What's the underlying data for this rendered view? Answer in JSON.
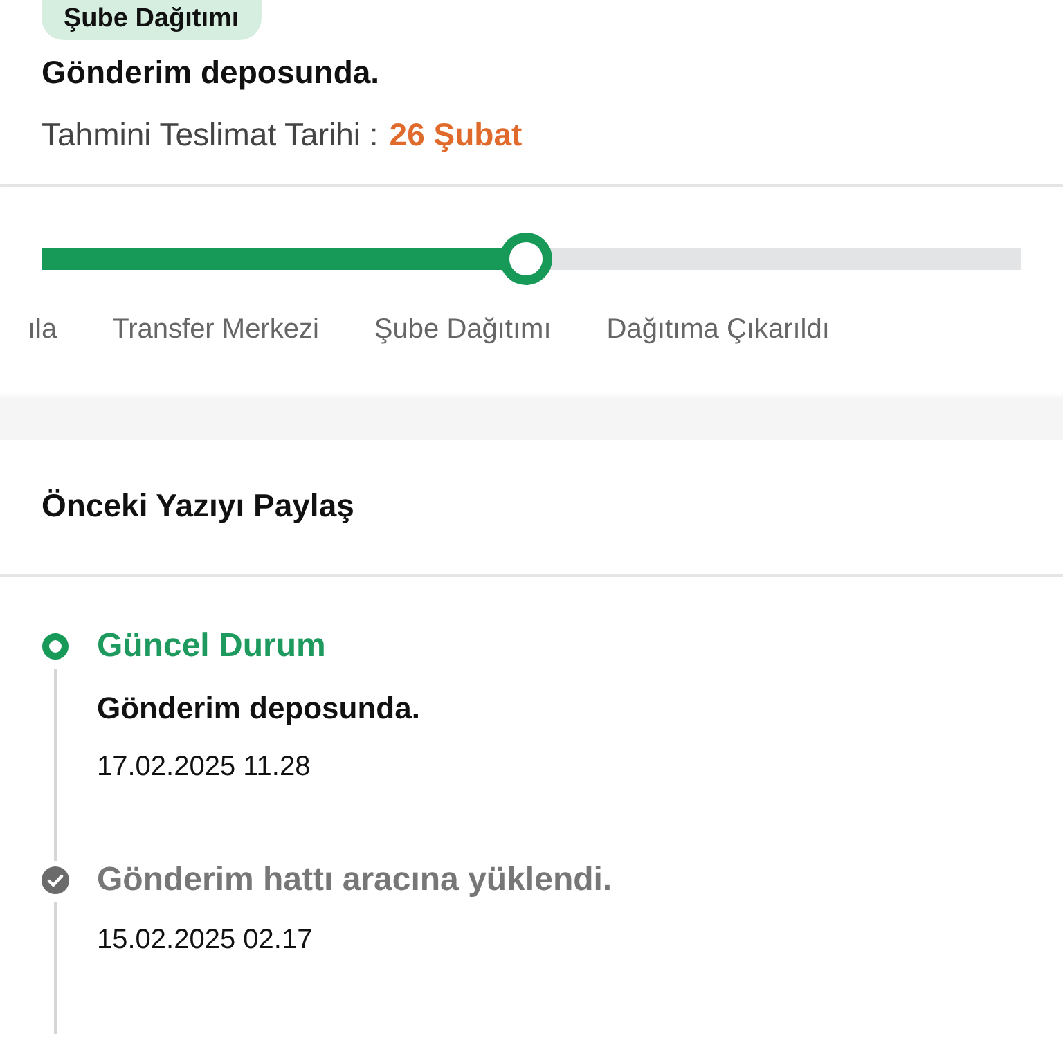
{
  "status_badge": "Şube Dağıtımı",
  "status_text": "Gönderim deposunda.",
  "delivery": {
    "label": "Tahmini Teslimat Tarihi :",
    "date": "26 Şubat"
  },
  "progress": {
    "level": 0.494,
    "steps": [
      "ıla",
      "Transfer Merkezi",
      "Şube Dağıtımı",
      "Dağıtıma Çıkarıldı"
    ]
  },
  "share": {
    "label": "Önceki Yazıyı Paylaş"
  },
  "timeline": [
    {
      "kind": "current",
      "title": "Güncel Durum",
      "description": "Gönderim deposunda.",
      "date": "17.02.2025 11.28"
    },
    {
      "kind": "done",
      "title": "Gönderim hattı aracına yüklendi.",
      "date": "15.02.2025 02.17"
    }
  ]
}
